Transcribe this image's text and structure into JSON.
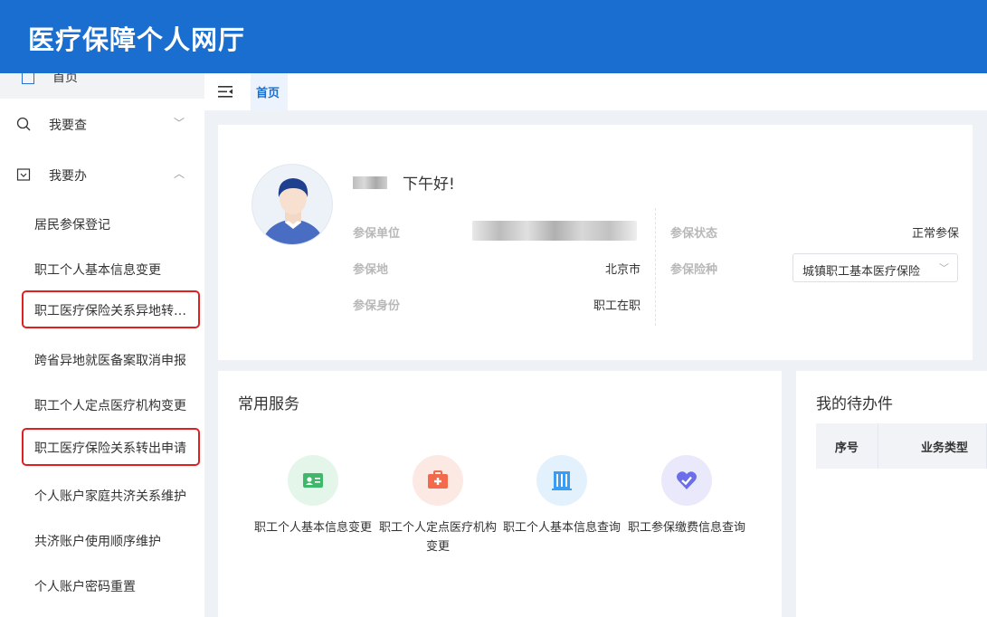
{
  "header": {
    "title": "医疗保障个人网厅"
  },
  "sidebar": {
    "home_label": "首页",
    "groups": [
      {
        "label": "我要查",
        "chevron": "﹀"
      },
      {
        "label": "我要办",
        "chevron": "︿"
      }
    ],
    "items": [
      {
        "label": "居民参保登记"
      },
      {
        "label": "职工个人基本信息变更"
      },
      {
        "label": "职工医疗保险关系异地转…"
      },
      {
        "label": "跨省异地就医备案取消申报"
      },
      {
        "label": "职工个人定点医疗机构变更"
      },
      {
        "label": "职工医疗保险关系转出申请"
      },
      {
        "label": "个人账户家庭共济关系维护"
      },
      {
        "label": "共济账户使用顺序维护"
      },
      {
        "label": "个人账户密码重置"
      }
    ]
  },
  "tabs": [
    {
      "label": "首页"
    }
  ],
  "profile": {
    "greeting": "下午好!",
    "labels": {
      "unit": "参保单位",
      "place": "参保地",
      "identity": "参保身份",
      "status": "参保状态",
      "insurance_type": "参保险种"
    },
    "values": {
      "place": "北京市",
      "identity": "职工在职",
      "status": "正常参保",
      "insurance_type": "城镇职工基本医疗保险"
    }
  },
  "services": {
    "title": "常用服务",
    "items": [
      {
        "label": "职工个人基本信息变更",
        "icon": "id-card-icon",
        "color": "#3fb86b",
        "bg": "#e4f6ea"
      },
      {
        "label": "职工个人定点医疗机构变更",
        "icon": "medical-kit-icon",
        "color": "#f26a4b",
        "bg": "#fde9e3"
      },
      {
        "label": "职工个人基本信息查询",
        "icon": "building-icon",
        "color": "#3a9cf2",
        "bg": "#e3f1fd"
      },
      {
        "label": "职工参保缴费信息查询",
        "icon": "heart-check-icon",
        "color": "#6b6ee8",
        "bg": "#e9e9fb"
      }
    ]
  },
  "todo": {
    "title": "我的待办件",
    "columns": [
      "序号",
      "业务类型"
    ]
  },
  "colors": {
    "brand": "#1a6ed0",
    "highlight_box": "#e02020"
  }
}
